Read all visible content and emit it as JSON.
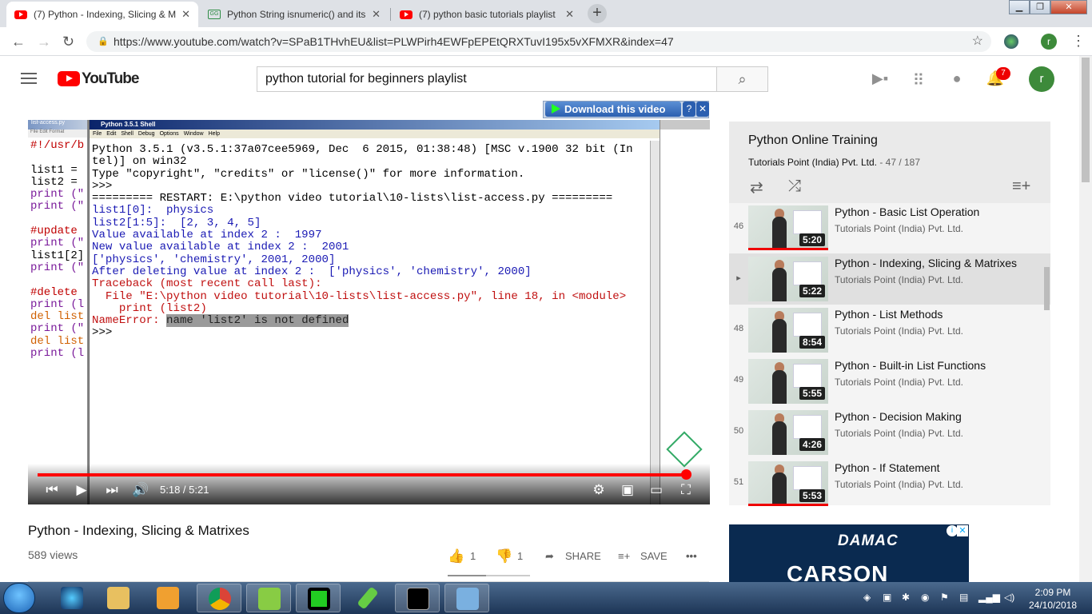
{
  "browser": {
    "tabs": [
      {
        "title": "(7) Python - Indexing, Slicing & M",
        "active": true,
        "favicon": "youtube-favicon"
      },
      {
        "title": "Python String isnumeric() and its",
        "active": false,
        "favicon": "geeksforgeeks-favicon"
      },
      {
        "title": "(7) python basic tutorials playlist",
        "active": false,
        "favicon": "youtube-favicon"
      }
    ],
    "url": "https://www.youtube.com/watch?v=SPaB1THvhEU&list=PLWPirh4EWFpEPEtQRXTuvI195x5vXFMXR&index=47",
    "profile_initial": "r"
  },
  "youtube": {
    "logo_text": "YouTube",
    "search_value": "python tutorial for beginners playlist",
    "notification_count": "7",
    "avatar_initial": "r"
  },
  "video": {
    "download_label": "Download this video",
    "current_time": "5:18",
    "duration": "5:21",
    "time_display": "5:18 / 5:21",
    "progress_fraction": 0.99,
    "idle_left_pane": {
      "title": "list-access.py",
      "lines": [
        "#!/usr/b",
        "",
        "list1 =",
        "list2 =",
        "print (\"",
        "print (\"",
        "",
        "#update",
        "print (\"",
        "list1[2]",
        "print (\"",
        "",
        "#delete",
        "print (l",
        "del list",
        "print (\"",
        "del list",
        "print (l"
      ]
    },
    "shell": {
      "title": "Python 3.5.1 Shell",
      "menu": [
        "File",
        "Edit",
        "Shell",
        "Debug",
        "Options",
        "Window",
        "Help"
      ],
      "lines": [
        {
          "text": "Python 3.5.1 (v3.5.1:37a07cee5969, Dec  6 2015, 01:38:48) [MSC v.1900 32 bit (In",
          "color": "#000"
        },
        {
          "text": "tel)] on win32",
          "color": "#000"
        },
        {
          "text": "Type \"copyright\", \"credits\" or \"license()\" for more information.",
          "color": "#000"
        },
        {
          "text": ">>> ",
          "color": "#000"
        },
        {
          "text": "========= RESTART: E:\\python video tutorial\\10-lists\\list-access.py =========",
          "color": "#000"
        },
        {
          "text": "list1[0]:  physics",
          "color": "#1a1ab4"
        },
        {
          "text": "list2[1:5]:  [2, 3, 4, 5]",
          "color": "#1a1ab4"
        },
        {
          "text": "Value available at index 2 :  1997",
          "color": "#1a1ab4"
        },
        {
          "text": "New value available at index 2 :  2001",
          "color": "#1a1ab4"
        },
        {
          "text": "['physics', 'chemistry', 2001, 2000]",
          "color": "#1a1ab4"
        },
        {
          "text": "After deleting value at index 2 :  ['physics', 'chemistry', 2000]",
          "color": "#1a1ab4"
        },
        {
          "text": "Traceback (most recent call last):",
          "color": "#c01010"
        },
        {
          "text": "  File \"E:\\python video tutorial\\10-lists\\list-access.py\", line 18, in <module>",
          "color": "#c01010"
        },
        {
          "text": "    print (list2)",
          "color": "#c01010"
        },
        {
          "text": "NameError: name 'list2' is not defined",
          "color": "#c01010"
        },
        {
          "text": ">>> ",
          "color": "#000"
        }
      ]
    }
  },
  "info": {
    "title": "Python - Indexing, Slicing & Matrixes",
    "views": "589 views",
    "likes": "1",
    "dislikes": "1",
    "share_label": "SHARE",
    "save_label": "SAVE"
  },
  "playlist": {
    "title": "Python Online Training",
    "channel": "Tutorials Point (India) Pvt. Ltd.",
    "position": "- 47 / 187",
    "items": [
      {
        "index": "46",
        "title": "Python - Basic List Operation",
        "channel": "Tutorials Point (India) Pvt. Ltd.",
        "duration": "5:20",
        "watched": true
      },
      {
        "index": "▸",
        "title": "Python - Indexing, Slicing & Matrixes",
        "channel": "Tutorials Point (India) Pvt. Ltd.",
        "duration": "5:22",
        "watched": false
      },
      {
        "index": "48",
        "title": "Python - List Methods",
        "channel": "Tutorials Point (India) Pvt. Ltd.",
        "duration": "8:54",
        "watched": false
      },
      {
        "index": "49",
        "title": "Python - Built-in List Functions",
        "channel": "Tutorials Point (India) Pvt. Ltd.",
        "duration": "5:55",
        "watched": false
      },
      {
        "index": "50",
        "title": "Python - Decision Making",
        "channel": "Tutorials Point (India) Pvt. Ltd.",
        "duration": "4:26",
        "watched": false
      },
      {
        "index": "51",
        "title": "Python - If Statement",
        "channel": "Tutorials Point (India) Pvt. Ltd.",
        "duration": "5:53",
        "watched": true
      }
    ]
  },
  "ad": {
    "brand": "DAMAC",
    "headline": "CARSON"
  },
  "taskbar": {
    "time": "2:09 PM",
    "date": "24/10/2018"
  },
  "colors": {
    "youtube_red": "#ff0000",
    "progress": "#ff0000",
    "avatar": "#3d8a3a"
  }
}
